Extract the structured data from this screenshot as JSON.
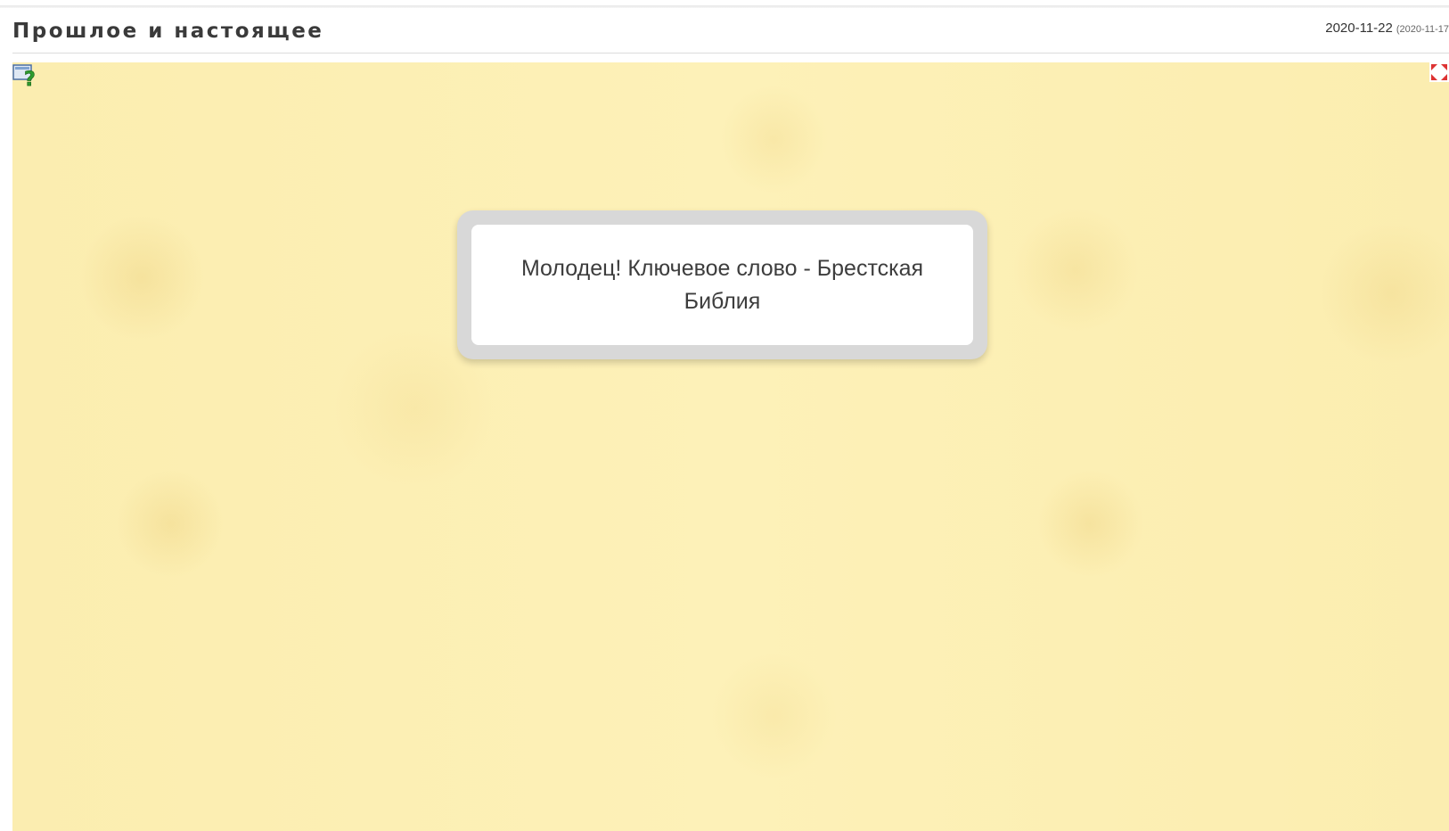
{
  "header": {
    "title": "Прошлое и настоящее",
    "date": "2020-11-22",
    "date_secondary": "(2020-11-17"
  },
  "stage": {
    "background_color": "#fdf0b4",
    "help_icon": "help-question-icon",
    "fullscreen_icon": "fullscreen-icon"
  },
  "dialog": {
    "message": "Молодец! Ключевое слово - Брестская Библия"
  }
}
